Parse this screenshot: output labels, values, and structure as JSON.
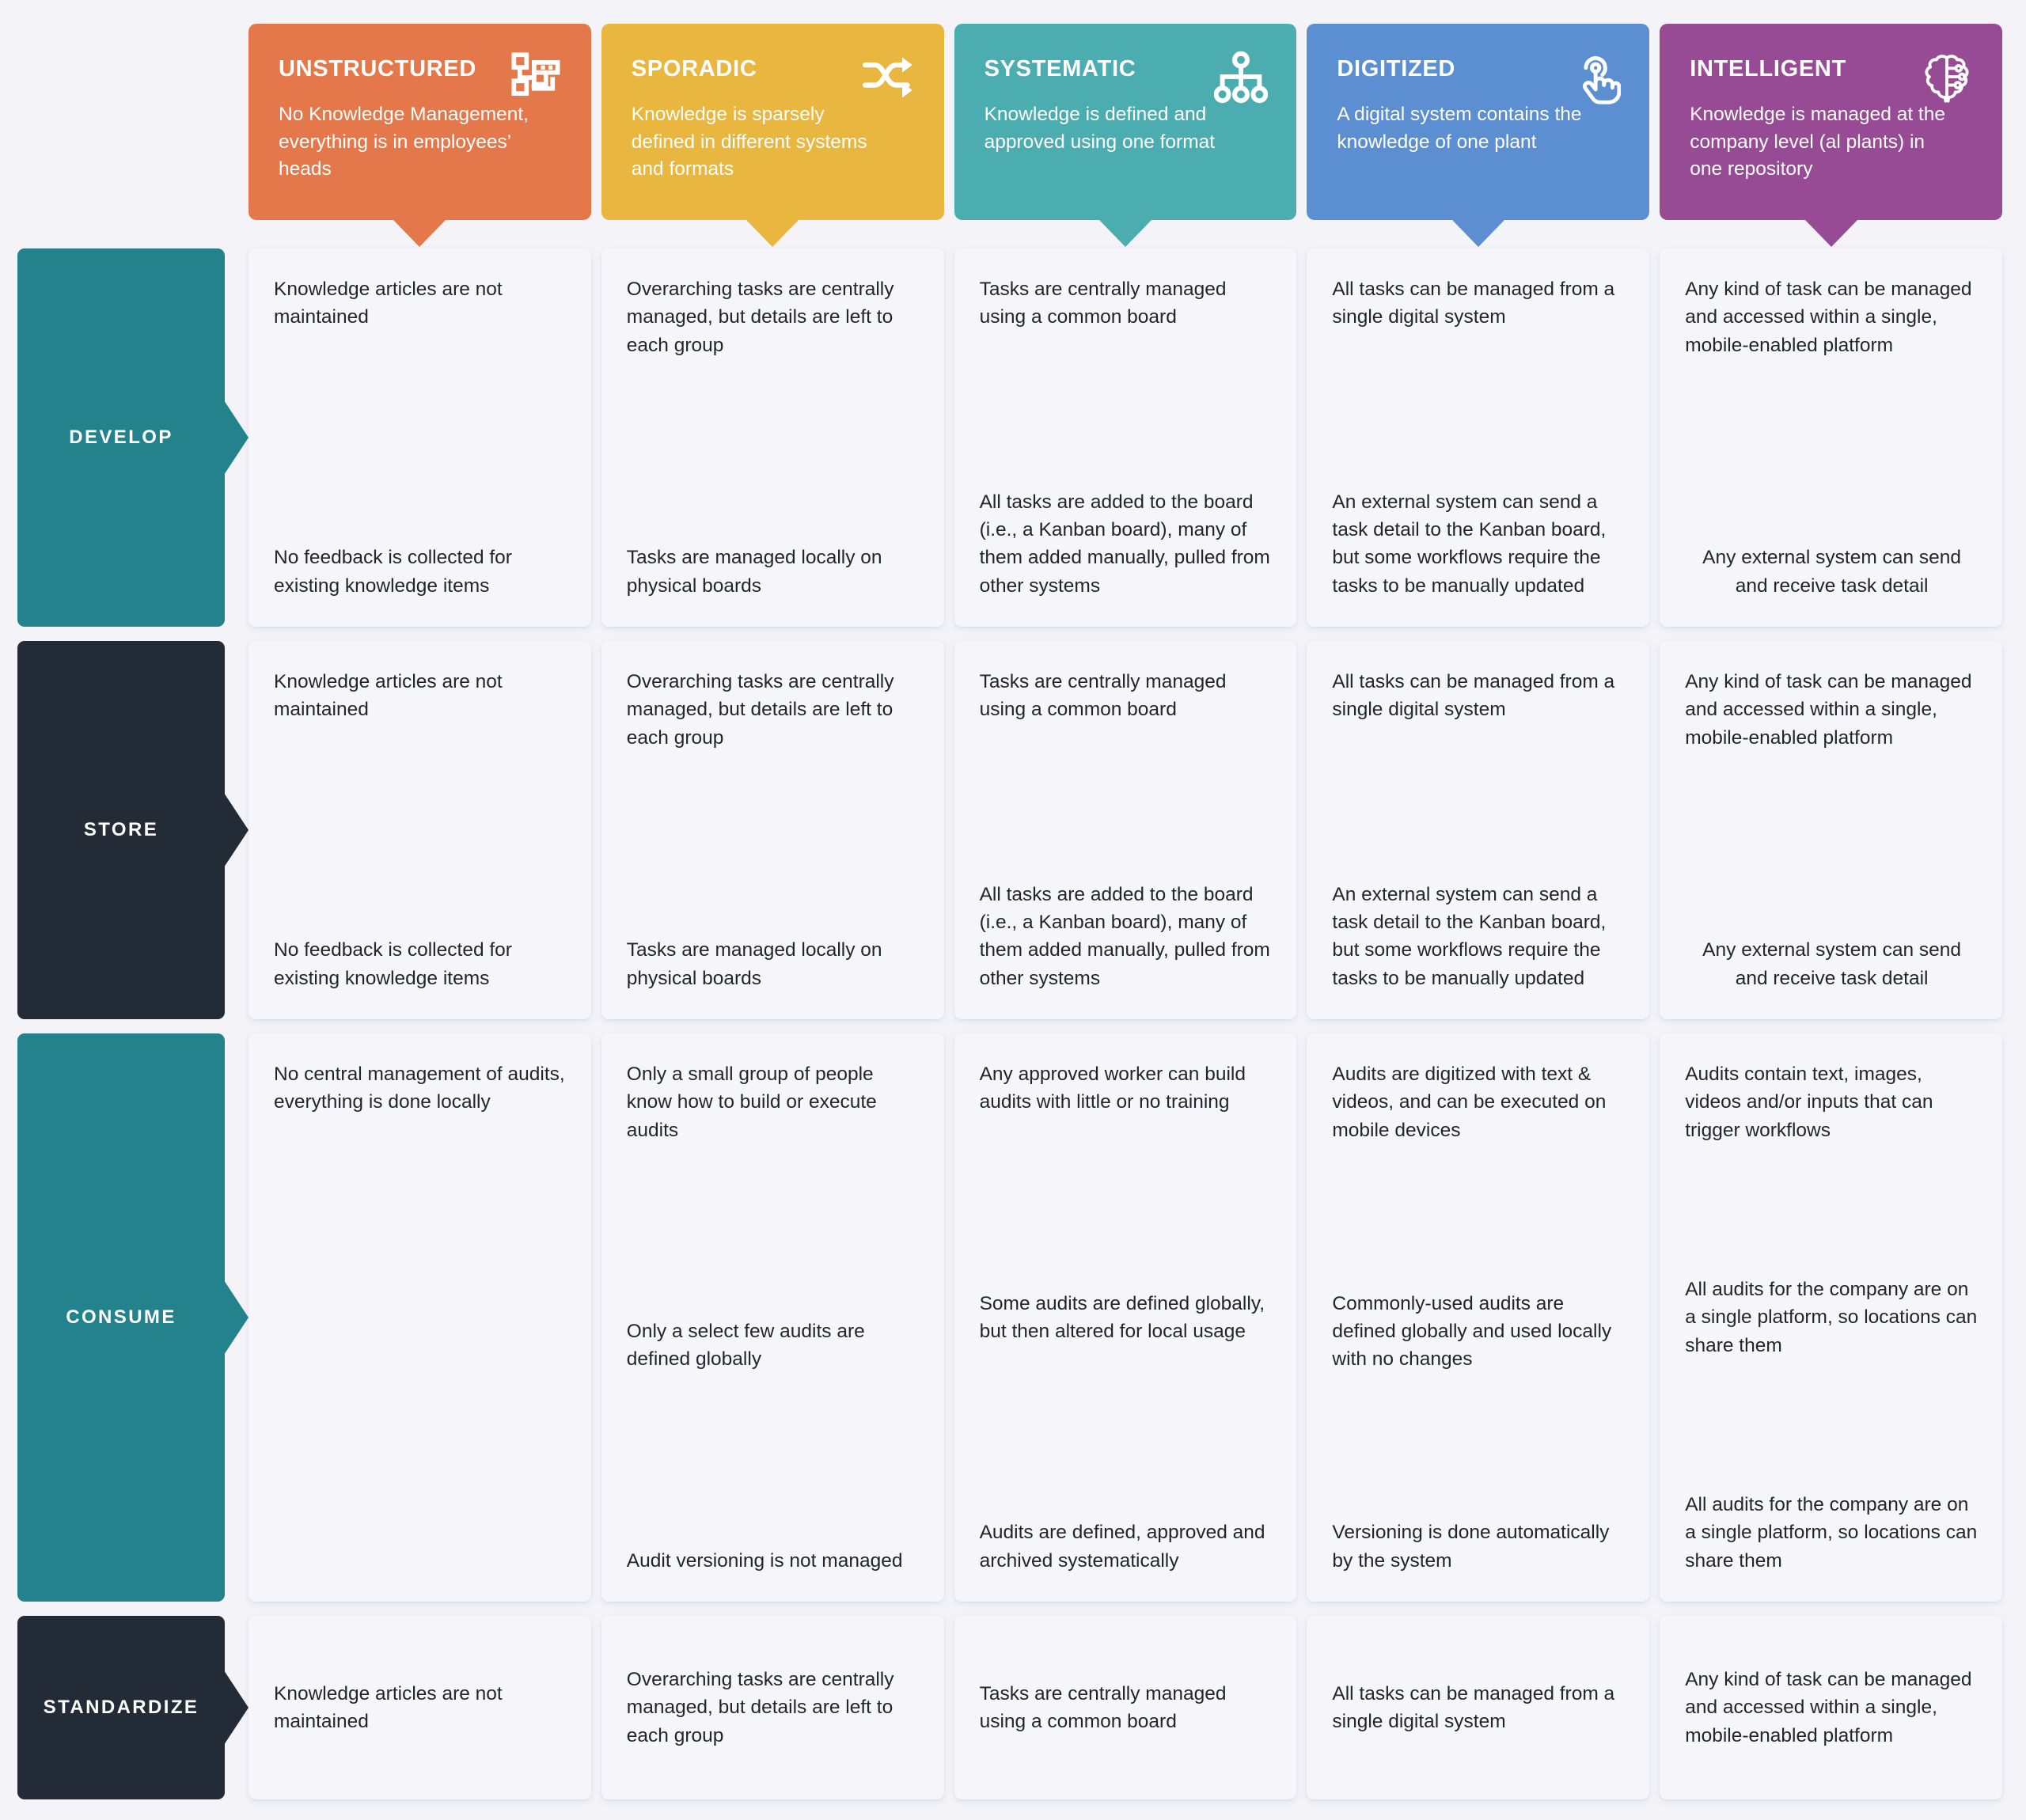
{
  "theme": {
    "page_background": "#f3f3f8",
    "cell_background": "#f5f5fa",
    "text_color": "#21262e"
  },
  "columns": [
    {
      "title": "UNSTRUCTURED",
      "description": "No Knowledge Management, everything is in employees’ heads",
      "color": "#e4784a",
      "icon": "blocks-icon"
    },
    {
      "title": "SPORADIC",
      "description": "Knowledge is sparsely defined in different systems and formats",
      "color": "#e9b63f",
      "icon": "shuffle-icon"
    },
    {
      "title": "SYSTEMATIC",
      "description": "Knowledge is defined and approved using one format",
      "color": "#4cadb0",
      "icon": "hierarchy-icon"
    },
    {
      "title": "DIGITIZED",
      "description": "A digital system contains the knowledge of one plant",
      "color": "#5b8fd1",
      "icon": "tap-hand-icon"
    },
    {
      "title": "INTELLIGENT",
      "description": "Knowledge is managed at the company level  (al plants) in one repository",
      "color": "#974b94",
      "icon": "ai-brain-icon"
    }
  ],
  "rows": [
    {
      "label": "DEVELOP",
      "color": "#23828c",
      "cells": [
        {
          "items": [
            {
              "text": "Knowledge articles are not maintained",
              "align": "left"
            },
            {
              "text": "No feedback is collected for existing knowledge items",
              "align": "left"
            }
          ]
        },
        {
          "items": [
            {
              "text": "Overarching tasks are centrally managed, but details are left to each group",
              "align": "left"
            },
            {
              "text": "Tasks are managed locally on physical boards",
              "align": "left"
            }
          ]
        },
        {
          "items": [
            {
              "text": "Tasks are centrally managed using a common board",
              "align": "left"
            },
            {
              "text": "All tasks are added to the board (i.e., a Kanban board), many of them added manually, pulled from other systems",
              "align": "left"
            }
          ]
        },
        {
          "items": [
            {
              "text": "All tasks can be managed from a single digital system",
              "align": "left"
            },
            {
              "text": "An external system can send a task detail to the Kanban board, but some workflows require the tasks to be manually updated",
              "align": "left"
            }
          ]
        },
        {
          "items": [
            {
              "text": "Any kind of task can be managed and accessed within a single, mobile-enabled platform",
              "align": "left"
            },
            {
              "text": "Any external system can send and receive task detail",
              "align": "center"
            }
          ]
        }
      ]
    },
    {
      "label": "STORE",
      "color": "#232c36",
      "cells": [
        {
          "items": [
            {
              "text": "Knowledge articles are not maintained",
              "align": "left"
            },
            {
              "text": "No feedback is collected for existing knowledge items",
              "align": "left"
            }
          ]
        },
        {
          "items": [
            {
              "text": "Overarching tasks are centrally managed, but details are left to each group",
              "align": "left"
            },
            {
              "text": "Tasks are managed locally on physical boards",
              "align": "left"
            }
          ]
        },
        {
          "items": [
            {
              "text": "Tasks are centrally managed using a common board",
              "align": "left"
            },
            {
              "text": "All tasks are added to the board (i.e., a Kanban board), many of them added manually, pulled from other systems",
              "align": "left"
            }
          ]
        },
        {
          "items": [
            {
              "text": "All tasks can be managed from a single digital system",
              "align": "left"
            },
            {
              "text": "An external system can send a task detail to the Kanban board, but some workflows require the tasks to be manually updated",
              "align": "left"
            }
          ]
        },
        {
          "items": [
            {
              "text": "Any kind of task can be managed and accessed within a single, mobile-enabled platform",
              "align": "left"
            },
            {
              "text": "Any external system can send and receive task detail",
              "align": "center"
            }
          ]
        }
      ]
    },
    {
      "label": "CONSUME",
      "color": "#23828c",
      "cells": [
        {
          "items": [
            {
              "text": "No central management of audits, everything is done locally",
              "align": "left"
            }
          ]
        },
        {
          "items": [
            {
              "text": "Only a small group of people know how to build or execute audits",
              "align": "left"
            },
            {
              "text": "Only a select few audits are defined globally",
              "align": "left"
            },
            {
              "text": "Audit versioning is not managed",
              "align": "left"
            }
          ]
        },
        {
          "items": [
            {
              "text": "Any approved worker can build audits with little or no training",
              "align": "left"
            },
            {
              "text": "Some audits are defined globally, but then altered for local usage",
              "align": "left"
            },
            {
              "text": "Audits are defined, approved and archived systematically",
              "align": "left"
            }
          ]
        },
        {
          "items": [
            {
              "text": "Audits are digitized with text & videos, and can be executed on mobile devices",
              "align": "left"
            },
            {
              "text": "Commonly-used audits are defined globally and used locally with no changes",
              "align": "left"
            },
            {
              "text": "Versioning is done automatically by the system",
              "align": "left"
            }
          ]
        },
        {
          "items": [
            {
              "text": "Audits contain text, images, videos and/or inputs that can trigger workflows",
              "align": "left"
            },
            {
              "text": "All audits for the company are on a single platform, so locations can share them",
              "align": "left"
            },
            {
              "text": "All audits for the company are on a single platform, so locations can share them",
              "align": "left"
            }
          ]
        }
      ]
    },
    {
      "label": "STANDARDIZE",
      "color": "#232c36",
      "cells": [
        {
          "items": [
            {
              "text": "Knowledge articles are not maintained",
              "align": "left"
            }
          ]
        },
        {
          "items": [
            {
              "text": "Overarching tasks are centrally managed, but details are left to each group",
              "align": "left"
            }
          ]
        },
        {
          "items": [
            {
              "text": "Tasks are centrally managed using a common board",
              "align": "left"
            }
          ]
        },
        {
          "items": [
            {
              "text": "All tasks can be managed from a single digital system",
              "align": "left"
            }
          ]
        },
        {
          "items": [
            {
              "text": "Any kind of task can be managed and accessed within a single, mobile-enabled platform",
              "align": "left"
            }
          ]
        }
      ]
    }
  ]
}
